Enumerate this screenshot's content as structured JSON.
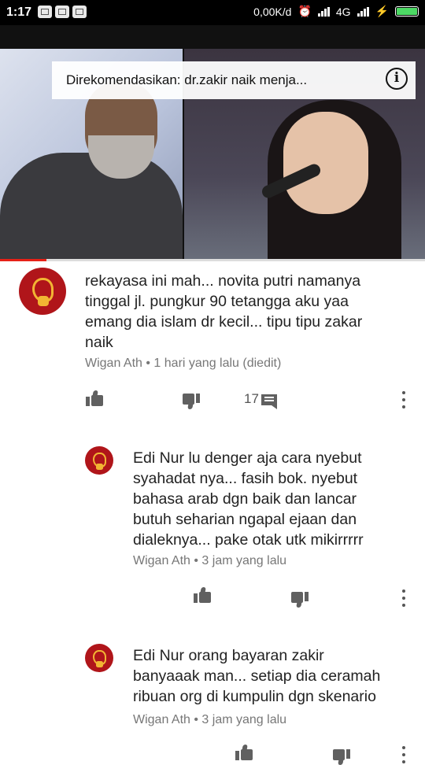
{
  "status_bar": {
    "time": "1:17",
    "network_speed": "0,00K/d",
    "network_type": "4G",
    "notification_icons": [
      "bbm-icon",
      "bbm-icon",
      "bbm-icon"
    ]
  },
  "video": {
    "banner_text": "Direkomendasikan: dr.zakir naik menja...",
    "progress_fraction": 0.11,
    "progress_color": "#e62117"
  },
  "comments": [
    {
      "lines": [
        "rekayasa ini mah... novita putri namanya",
        "tinggal jl. pungkur 90 tetangga aku yaa",
        "emang dia islam dr kecil... tipu tipu zakar",
        "naik"
      ],
      "meta": "Wigan Ath • 1 hari yang lalu (diedit)",
      "reply_count": "17"
    },
    {
      "lines": [
        "Edi Nur lu denger aja cara nyebut",
        "syahadat nya... fasih bok. nyebut",
        "bahasa arab dgn baik dan lancar",
        "butuh seharian ngapal ejaan dan",
        "dialeknya... pake otak utk mikirrrrr"
      ],
      "meta": "Wigan Ath • 3 jam yang lalu"
    },
    {
      "lines": [
        "Edi Nur orang bayaran zakir",
        "banyaaak man... setiap dia ceramah",
        "ribuan org di kumpulin dgn skenario"
      ],
      "meta": "Wigan Ath • 3 jam yang lalu"
    }
  ],
  "colors": {
    "avatar_bg": "#b0151a",
    "avatar_fg": "#f2b533",
    "icon_gray": "#606060"
  }
}
